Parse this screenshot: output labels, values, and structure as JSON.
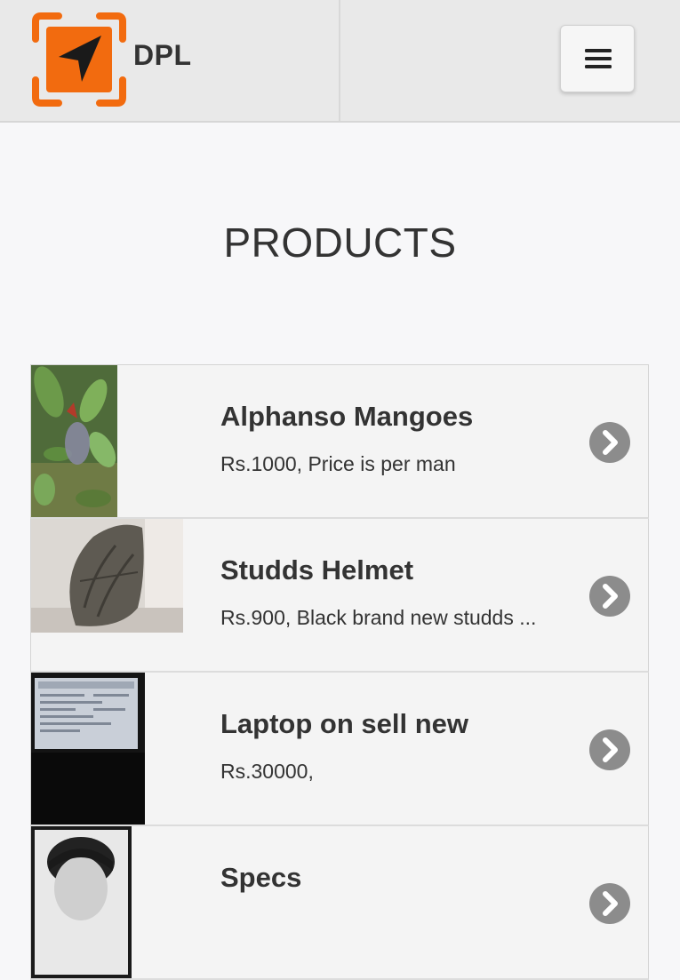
{
  "header": {
    "brand": "DPL",
    "logo_icon": "navigation-arrow-icon",
    "menu_icon": "hamburger-menu-icon",
    "colors": {
      "logo_orange": "#f26b0f",
      "header_bg": "#e9e9e9"
    }
  },
  "main": {
    "title": "PRODUCTS",
    "products": [
      {
        "title": "Alphanso Mangoes",
        "desc": "Rs.1000, Price is per man",
        "thumb": "mango-tree-photo",
        "chevron_icon": "chevron-right-circle-icon"
      },
      {
        "title": "Studds Helmet",
        "desc": "Rs.900, Black brand new studds ...",
        "thumb": "helmet-photo",
        "chevron_icon": "chevron-right-circle-icon"
      },
      {
        "title": "Laptop on sell new",
        "desc": "Rs.30000,",
        "thumb": "laptop-photo",
        "chevron_icon": "chevron-right-circle-icon"
      },
      {
        "title": "Specs",
        "desc": "",
        "thumb": "person-photo",
        "chevron_icon": "chevron-right-circle-icon"
      }
    ]
  }
}
